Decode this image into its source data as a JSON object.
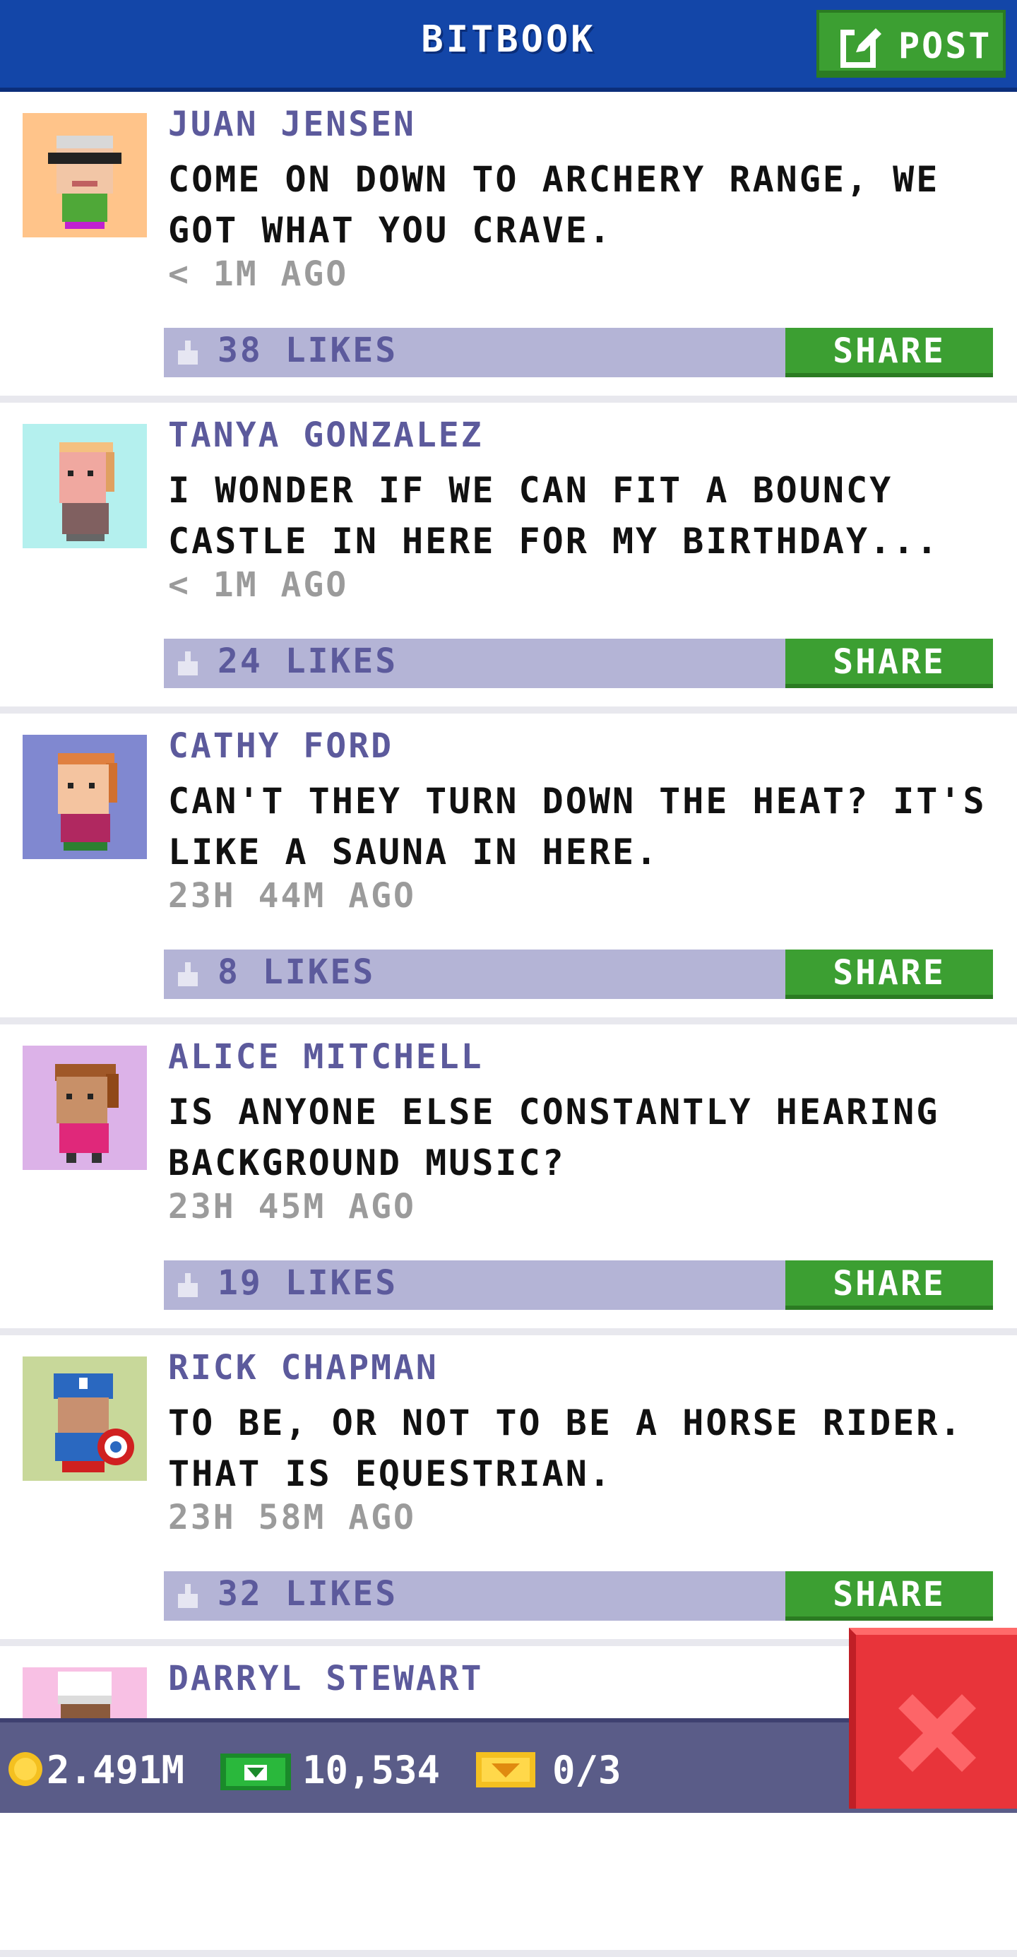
{
  "header": {
    "title": "BITBOOK",
    "post_label": "POST"
  },
  "posts": [
    {
      "author": "JUAN JENSEN",
      "message": "COME ON DOWN TO ARCHERY RANGE, WE GOT WHAT YOU CRAVE.",
      "time": "< 1M AGO",
      "likes": "38 LIKES",
      "share": "SHARE",
      "avatar_bg": "#ffc48a"
    },
    {
      "author": "TANYA GONZALEZ",
      "message": "I WONDER IF WE CAN FIT A BOUNCY CASTLE IN HERE FOR MY BIRTHDAY...",
      "time": "< 1M AGO",
      "likes": "24 LIKES",
      "share": "SHARE",
      "avatar_bg": "#b4f0ee"
    },
    {
      "author": "CATHY FORD",
      "message": "CAN'T THEY TURN DOWN THE HEAT? IT'S LIKE A SAUNA IN HERE.",
      "time": "23H 44M AGO",
      "likes": "8 LIKES",
      "share": "SHARE",
      "avatar_bg": "#8088d0"
    },
    {
      "author": "ALICE MITCHELL",
      "message": "IS ANYONE ELSE CONSTANTLY HEARING BACKGROUND MUSIC?",
      "time": "23H 45M AGO",
      "likes": "19 LIKES",
      "share": "SHARE",
      "avatar_bg": "#dcb2e8"
    },
    {
      "author": "RICK CHAPMAN",
      "message": "TO BE, OR NOT TO BE A HORSE RIDER. THAT IS EQUESTRIAN.",
      "time": "23H 58M AGO",
      "likes": "32 LIKES",
      "share": "SHARE",
      "avatar_bg": "#c8d89a"
    },
    {
      "author": "DARRYL STEWART",
      "message": "",
      "time": "",
      "likes": "",
      "share": "",
      "avatar_bg": "#f8c0e4"
    }
  ],
  "bottom_bar": {
    "coins": "2.491M",
    "bux": "10,534",
    "tickets": "0/3"
  },
  "icons": {
    "post": "edit-icon",
    "like": "thumbs-up-icon",
    "coin": "coin-icon",
    "bux": "cash-icon",
    "ticket": "ticket-icon",
    "close": "close-icon"
  },
  "colors": {
    "header": "#1346a8",
    "green": "#3c9f32",
    "likes_bar": "#b4b4d6",
    "author": "#5c5a9c",
    "close": "#e8343a"
  }
}
